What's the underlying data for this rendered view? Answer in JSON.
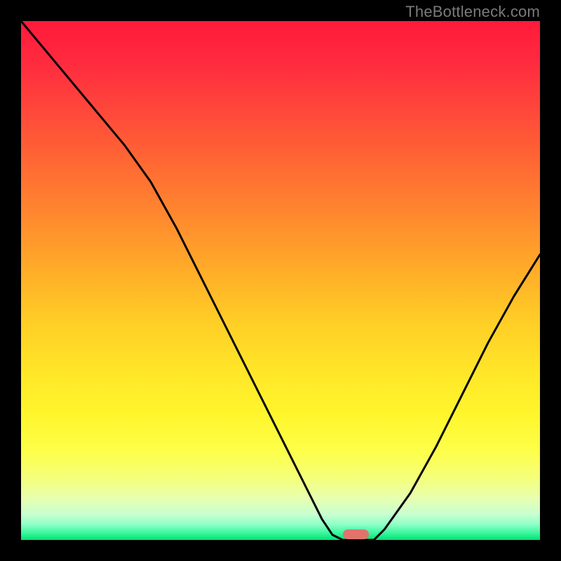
{
  "watermark": "TheBottleneck.com",
  "chart_data": {
    "type": "line",
    "title": "",
    "xlabel": "",
    "ylabel": "",
    "xlim": [
      0,
      100
    ],
    "ylim": [
      0,
      100
    ],
    "grid": false,
    "x": [
      0,
      5,
      10,
      15,
      20,
      25,
      30,
      35,
      40,
      45,
      50,
      55,
      58,
      60,
      62,
      65,
      68,
      70,
      75,
      80,
      85,
      90,
      95,
      100
    ],
    "values": [
      100,
      94,
      88,
      82,
      76,
      69,
      60,
      50,
      40,
      30,
      20,
      10,
      4,
      1,
      0,
      0,
      0,
      2,
      9,
      18,
      28,
      38,
      47,
      55
    ],
    "series_name": "bottleneck-curve",
    "marker": {
      "x_start": 62,
      "x_end": 67,
      "y": 0,
      "color": "#e0746c"
    },
    "background_gradient": {
      "top": "#ff1a3a",
      "mid": "#ffce26",
      "bottom": "#00e274"
    }
  }
}
